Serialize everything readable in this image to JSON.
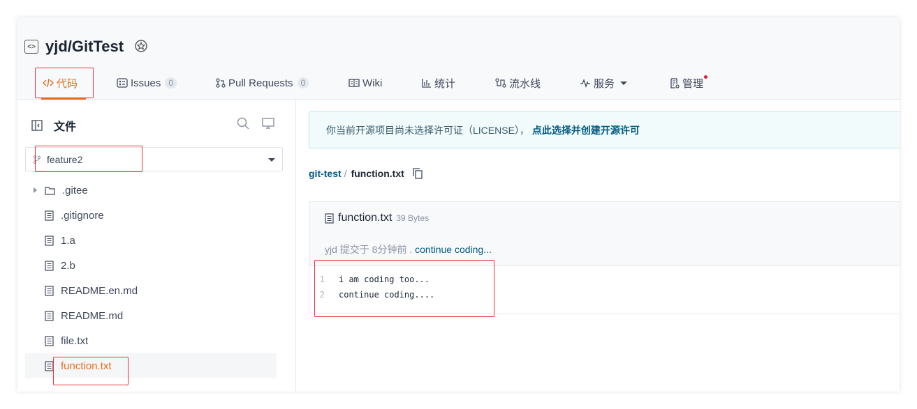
{
  "repo": {
    "name": "yjd/GitTest"
  },
  "tabs": [
    {
      "label": "代码",
      "active": true
    },
    {
      "label": "Issues",
      "count": "0"
    },
    {
      "label": "Pull Requests",
      "count": "0"
    },
    {
      "label": "Wiki"
    },
    {
      "label": "统计"
    },
    {
      "label": "流水线"
    },
    {
      "label": "服务"
    },
    {
      "label": "管理"
    }
  ],
  "sidebar": {
    "title": "文件",
    "branch": "feature2",
    "files": [
      {
        "name": ".gitee",
        "type": "folder"
      },
      {
        "name": ".gitignore",
        "type": "file"
      },
      {
        "name": "1.a",
        "type": "file"
      },
      {
        "name": "2.b",
        "type": "file"
      },
      {
        "name": "README.en.md",
        "type": "file"
      },
      {
        "name": "README.md",
        "type": "file"
      },
      {
        "name": "file.txt",
        "type": "file"
      },
      {
        "name": "function.txt",
        "type": "file",
        "selected": true
      }
    ]
  },
  "license": {
    "text": "你当前开源项目尚未选择许可证（LICENSE），",
    "link": "点此选择并创建开源许可"
  },
  "breadcrumb": {
    "repo": "git-test",
    "separator": "/",
    "file": "function.txt"
  },
  "file": {
    "name": "function.txt",
    "size": "39 Bytes",
    "commit_prefix": "yjd 提交于 8分钟前 .",
    "commit_message": "continue coding...",
    "lines": [
      {
        "no": "1",
        "text": "i am coding too..."
      },
      {
        "no": "2",
        "text": "continue coding...."
      }
    ]
  },
  "colors": {
    "accent": "#e66e1d",
    "link": "#005980",
    "highlight_box": "#e8333a"
  }
}
